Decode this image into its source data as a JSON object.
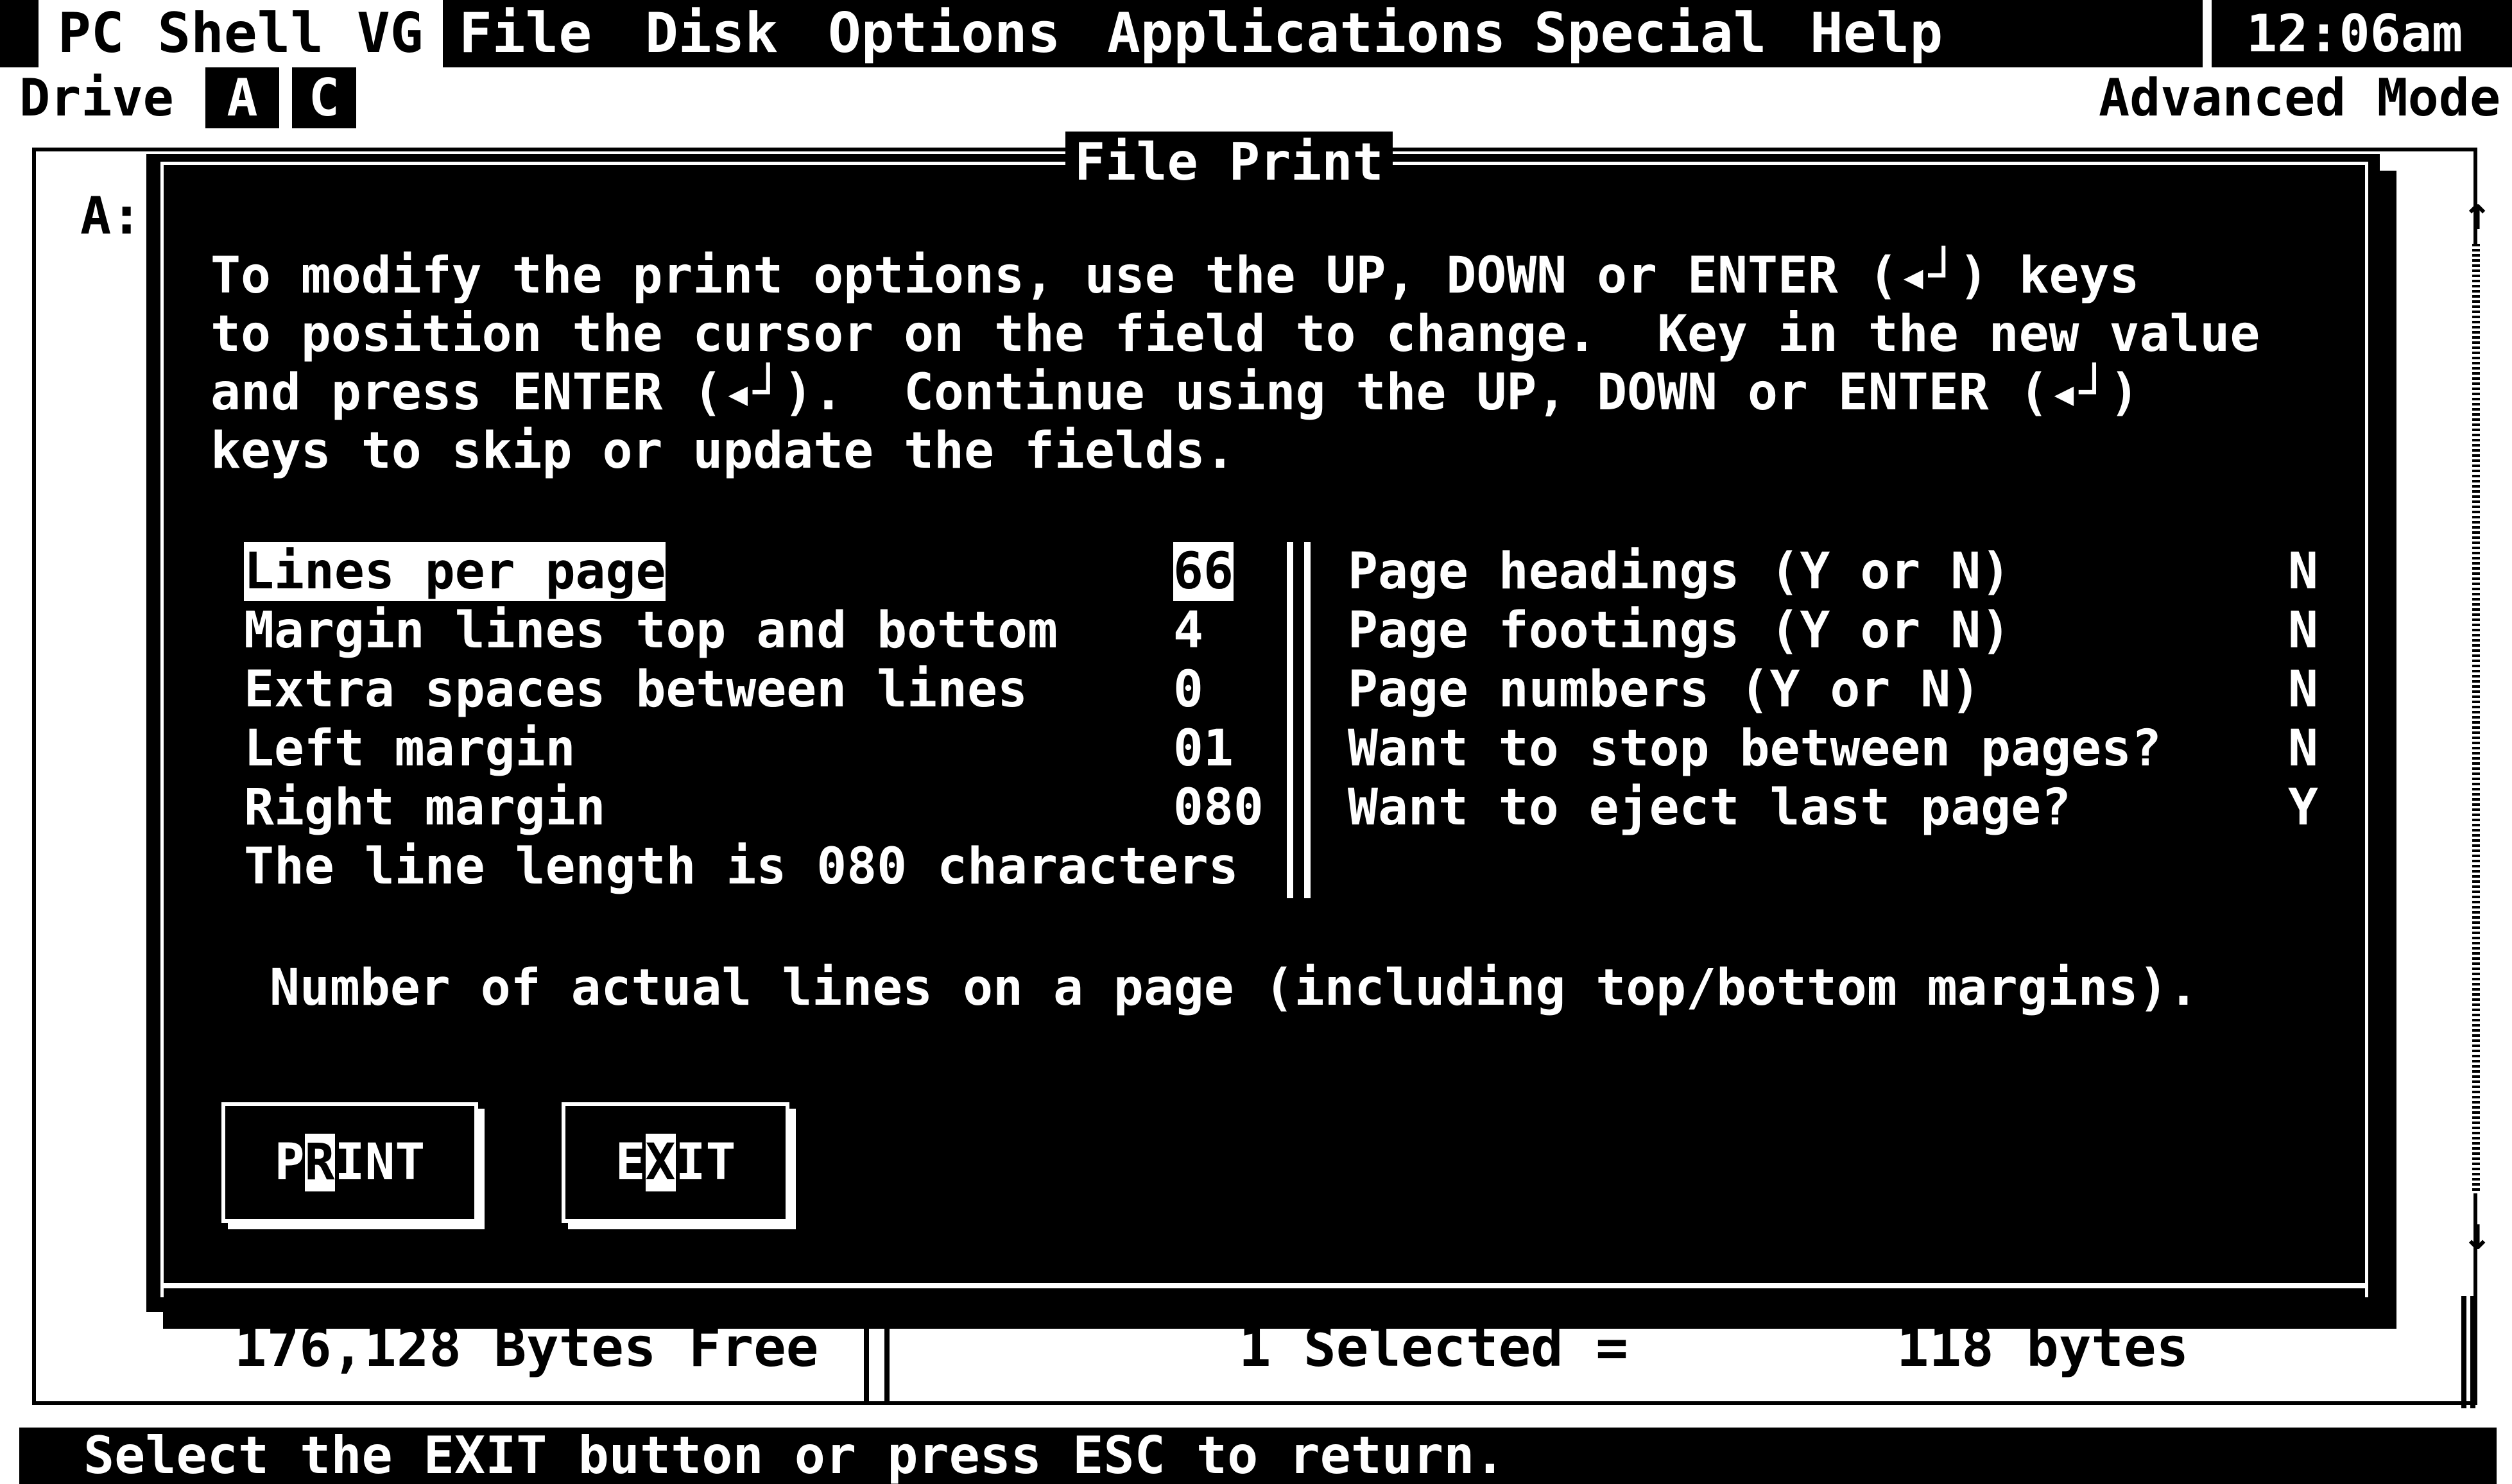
{
  "app": {
    "title": "PC Shell VG",
    "clock": "12:06am",
    "mode": "Advanced Mode"
  },
  "menu": {
    "items": [
      {
        "label": "File"
      },
      {
        "label": "Disk"
      },
      {
        "label": "Options"
      },
      {
        "label": "Applications"
      },
      {
        "label": "Special"
      },
      {
        "label": "Help"
      }
    ]
  },
  "drive": {
    "label": "Drive",
    "options": [
      "A",
      "C"
    ],
    "selected": "A"
  },
  "background_window": {
    "path_label": "A:"
  },
  "dialog": {
    "title": "File Print",
    "instructions": [
      "To modify the print options, use the UP, DOWN or ENTER (◂┘) keys",
      "to position the cursor on the field to change.  Key in the new value",
      "and press ENTER (◂┘).  Continue using the UP, DOWN or ENTER (◂┘)",
      "keys to skip or update the fields."
    ],
    "left_options": [
      {
        "label": "Lines per page",
        "value": "66"
      },
      {
        "label": "Margin lines top and bottom",
        "value": "4"
      },
      {
        "label": "Extra spaces between lines",
        "value": "0"
      },
      {
        "label": "Left margin",
        "value": "01"
      },
      {
        "label": "Right margin",
        "value": "080"
      }
    ],
    "line_length_text": "The line length is 080 characters",
    "right_options": [
      {
        "label": "Page headings (Y or N)",
        "value": "N"
      },
      {
        "label": "Page footings (Y or N)",
        "value": "N"
      },
      {
        "label": "Page numbers (Y or N)",
        "value": "N"
      },
      {
        "label": "Want to stop between pages?",
        "value": "N"
      },
      {
        "label": "Want to eject last page?",
        "value": "Y"
      }
    ],
    "help_text": "Number of actual lines on a page (including top/bottom margins).",
    "buttons": {
      "print": {
        "before": "P",
        "hotkey": "R",
        "after": "INT"
      },
      "exit": {
        "before": "E",
        "hotkey": "X",
        "after": "IT"
      }
    }
  },
  "info": {
    "bytes_free": "176,128 Bytes Free",
    "selected": "1 Selected =",
    "selected_size": "118 bytes"
  },
  "status": {
    "message": "Select the EXIT button or press ESC to return."
  }
}
